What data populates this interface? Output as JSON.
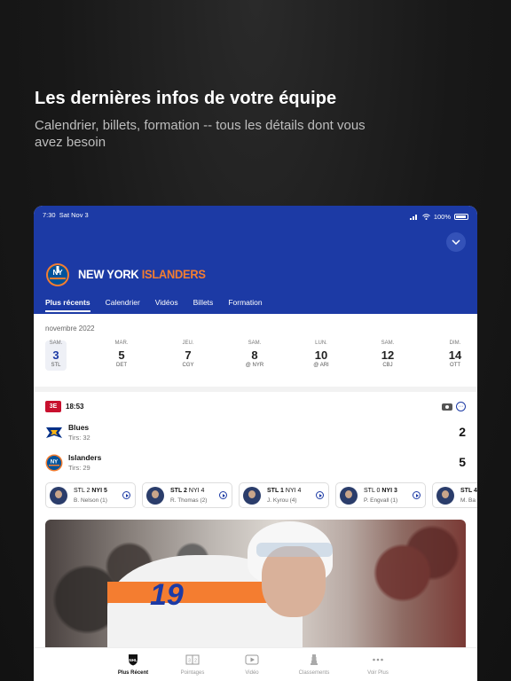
{
  "promo": {
    "title": "Les dernières infos de votre équipe",
    "subtitle": "Calendrier, billets, formation -- tous les détails dont vous avez besoin"
  },
  "status_bar": {
    "time": "7:30",
    "date": "Sat Nov 3",
    "battery": "100%"
  },
  "team": {
    "name_part1": "NEW YORK",
    "name_part2": "ISLANDERS"
  },
  "tabs": [
    {
      "label": "Plus récents",
      "active": true
    },
    {
      "label": "Calendrier"
    },
    {
      "label": "Vidéos"
    },
    {
      "label": "Billets"
    },
    {
      "label": "Formation"
    }
  ],
  "schedule": {
    "month": "novembre 2022",
    "days": [
      {
        "dow": "SAM.",
        "num": "3",
        "opp": "STL",
        "selected": true
      },
      {
        "dow": "MAR.",
        "num": "5",
        "opp": "DET"
      },
      {
        "dow": "JEU.",
        "num": "7",
        "opp": "CGY"
      },
      {
        "dow": "SAM.",
        "num": "8",
        "opp": "@ NYR"
      },
      {
        "dow": "LUN.",
        "num": "10",
        "opp": "@ ARI"
      },
      {
        "dow": "SAM.",
        "num": "12",
        "opp": "CBJ"
      },
      {
        "dow": "DIM.",
        "num": "14",
        "opp": "OTT"
      }
    ]
  },
  "game": {
    "period": "3E",
    "clock": "18:53",
    "teams": [
      {
        "name": "Blues",
        "shots": "Tirs: 32",
        "score": "2",
        "color": "#002f87"
      },
      {
        "name": "Islanders",
        "shots": "Tirs: 29",
        "score": "5",
        "color": "#00539b"
      }
    ]
  },
  "goals": [
    {
      "away": "STL 2",
      "home": "NYI 5",
      "scorer": "B. Nelson (1)",
      "bold": "home"
    },
    {
      "away": "STL 2",
      "home": "NYI 4",
      "scorer": "R. Thomas (2)",
      "bold": "away"
    },
    {
      "away": "STL 1",
      "home": "NYI 4",
      "scorer": "J. Kyrou (4)",
      "bold": "away"
    },
    {
      "away": "STL 0",
      "home": "NYI 3",
      "scorer": "P. Engvall (1)",
      "bold": "home"
    },
    {
      "away": "STL 4",
      "home": "",
      "scorer": "M. Ba",
      "bold": "away"
    }
  ],
  "tabbar": [
    {
      "label": "Plus Récent",
      "icon": "nhl-shield-icon",
      "active": true
    },
    {
      "label": "Pointages",
      "icon": "scoreboard-icon"
    },
    {
      "label": "Vidéo",
      "icon": "video-play-icon"
    },
    {
      "label": "Classements",
      "icon": "trophy-icon"
    },
    {
      "label": "Voir Plus",
      "icon": "more-dots-icon"
    }
  ],
  "colors": {
    "primary": "#1c3aa5",
    "accent": "#f47d30",
    "period_badge": "#c8102e"
  }
}
